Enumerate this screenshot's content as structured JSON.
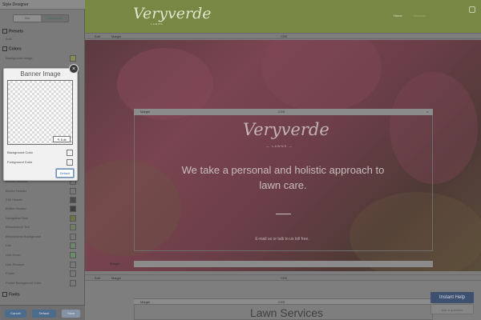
{
  "designer": {
    "title": "Style Designer",
    "tabs": [
      "Site",
      "Advanced"
    ],
    "sections": {
      "presets": "Presets",
      "colors": "Colors",
      "fonts": "Fonts"
    },
    "preset_value": "Auto",
    "top_rows": [
      "Background Image"
    ],
    "rows": [
      "Border Shadow",
      "Border Header",
      "SIM Header",
      "Button Header",
      "Navigation Side",
      "Breadcrumb Text",
      "Breadcrumb Background",
      "Link",
      "Link Hover",
      "Link Shadow",
      "Footer",
      "Footer Background Color"
    ],
    "footer": {
      "cancel": "Cancel",
      "default": "Default",
      "save": "Save"
    }
  },
  "banner_popup": {
    "title": "Banner Image",
    "edit_label": "✎ Edit",
    "rows": [
      "Background Color",
      "Foreground Color"
    ],
    "default_button": "Default"
  },
  "site": {
    "logo": "Veryverde",
    "logo_sub": "LAWNS",
    "nav": [
      "Home",
      "Services"
    ],
    "edit": "Edit",
    "margin": "Margin",
    "css": "CSS",
    "hero_logo": "Veryverde",
    "hero_logo_sub": "— LAWNS —",
    "tagline": "We take a personal and holistic approach to lawn care.",
    "email_line": "E-mail us or talk to us toll free.",
    "section_title": "Lawn Services"
  },
  "help": {
    "instant": "Instant Help",
    "ask": "Ask a question"
  },
  "colors": {
    "header_green": "#788744",
    "help_blue": "#3e5070",
    "default_blue": "#2f6fb0"
  }
}
